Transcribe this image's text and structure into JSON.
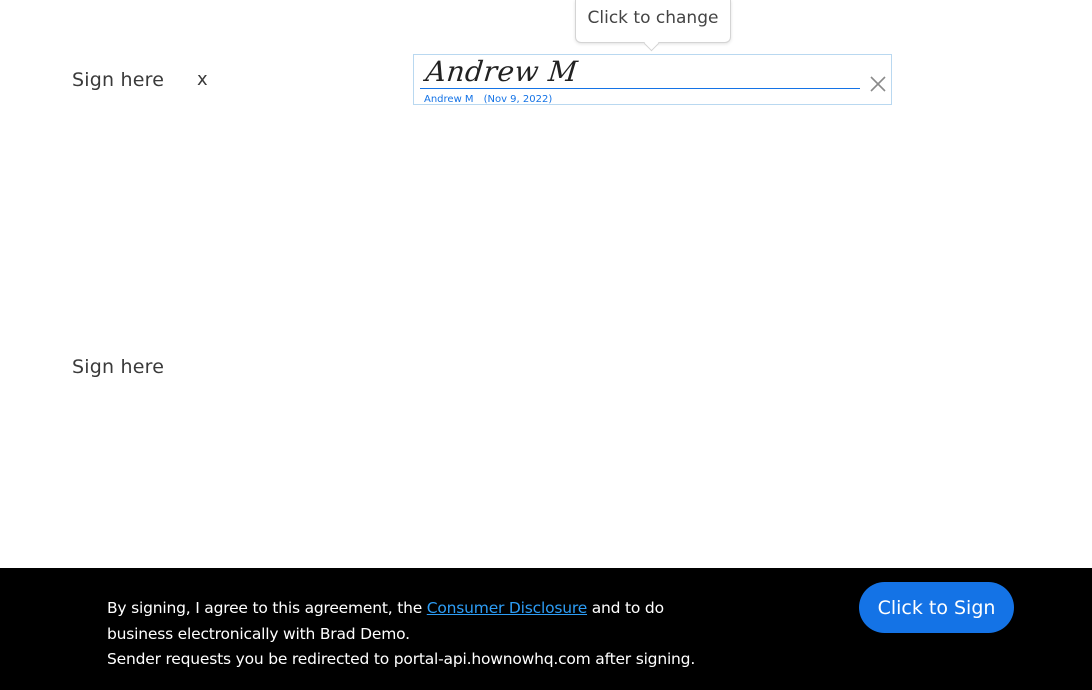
{
  "document": {
    "sign_label_1": "Sign here",
    "sign_marker_1": "x",
    "sign_label_2": "Sign here"
  },
  "signature_field": {
    "tooltip": "Click to change",
    "signature_text": "Andrew M",
    "signer_name": "Andrew M",
    "signed_date": "(Nov 9, 2022)",
    "close_icon": "close-icon"
  },
  "footer": {
    "agreement_prefix": "By signing, I agree to this agreement, the ",
    "consumer_disclosure_link": "Consumer Disclosure",
    "agreement_suffix": " and to do business electronically with Brad Demo.",
    "redirect_notice": "Sender requests you be redirected to portal-api.hownowhq.com after signing.",
    "sign_button_label": "Click to Sign"
  },
  "colors": {
    "accent": "#1473e6",
    "link": "#2d9df5",
    "footer_bg": "#000000",
    "field_border": "#b9d8f0"
  }
}
